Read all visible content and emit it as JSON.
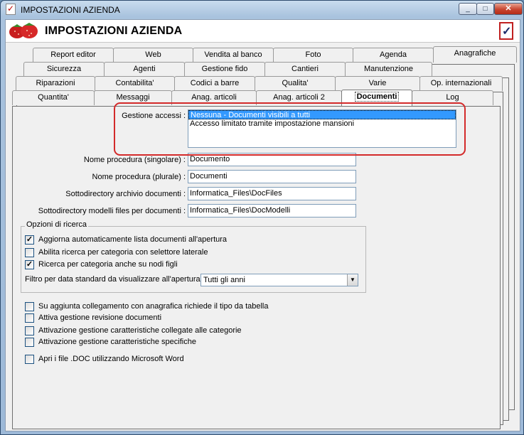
{
  "window": {
    "title": "IMPOSTAZIONI AZIENDA",
    "controls": {
      "minimize": "_",
      "maximize": "□",
      "close": "✕"
    }
  },
  "header": {
    "title": "IMPOSTAZIONI AZIENDA"
  },
  "tabs": {
    "row1": [
      "Report editor",
      "Web",
      "Vendita al banco",
      "Foto",
      "Agenda",
      "Anagrafiche"
    ],
    "row2": [
      "Sicurezza",
      "Agenti",
      "Gestione fido",
      "Cantieri",
      "Manutenzione"
    ],
    "row3": [
      "Riparazioni",
      "Contabilita'",
      "Codici a barre",
      "Qualita'",
      "Varie",
      "Op. internazionali"
    ],
    "row4": [
      "Quantita'",
      "Messaggi",
      "Anag. articoli",
      "Anag. articoli 2",
      "Documenti",
      "Log"
    ],
    "active": "Documenti"
  },
  "documenti": {
    "gestione_accessi": {
      "label": "Gestione accessi :",
      "options": [
        "Nessuna - Documenti visibili a tutti",
        "Accesso limitato tramite impostazione mansioni"
      ],
      "selected": "Nessuna - Documenti visibili a tutti"
    },
    "fields": [
      {
        "label": "Nome procedura (singolare) :",
        "value": "Documento"
      },
      {
        "label": "Nome procedura (plurale) :",
        "value": "Documenti"
      },
      {
        "label": "Sottodirectory archivio documenti :",
        "value": "Informatica_Files\\DocFiles"
      },
      {
        "label": "Sottodirectory modelli files per documenti :",
        "value": "Informatica_Files\\DocModelli"
      }
    ],
    "opzioni_ricerca": {
      "legend": "Opzioni di ricerca",
      "checks": [
        {
          "label": "Aggiorna automaticamente lista documenti all'apertura",
          "checked": true
        },
        {
          "label": "Abilita ricerca per categoria con selettore laterale",
          "checked": false
        },
        {
          "label": "Ricerca per categoria anche su nodi figli",
          "checked": true
        }
      ],
      "filtro_label": "Filtro per data standard da visualizzare all'apertura :",
      "filtro_value": "Tutti gli anni"
    },
    "other_checks": [
      {
        "label": "Su aggiunta collegamento con anagrafica richiede il tipo da tabella",
        "checked": false
      },
      {
        "label": "Attiva gestione revisione documenti",
        "checked": false
      },
      {
        "label": "Attivazione gestione caratteristiche collegate alle categorie",
        "checked": false
      },
      {
        "label": "Attivazione gestione caratteristiche specifiche",
        "checked": false
      },
      {
        "label": "Apri i file .DOC utilizzando Microsoft Word",
        "checked": false
      }
    ]
  },
  "colors": {
    "highlight": "#d32a2a",
    "selection": "#3399ff"
  }
}
